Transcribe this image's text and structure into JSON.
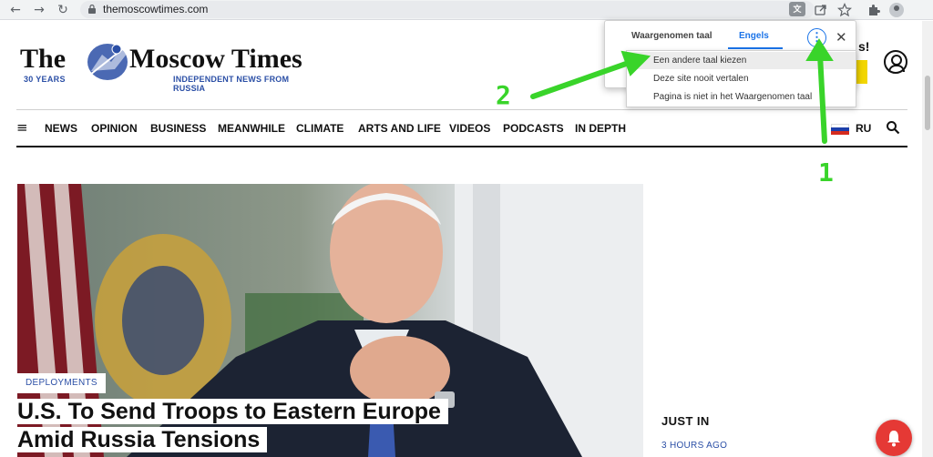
{
  "browser": {
    "url": "themoscowtimes.com",
    "back_icon": "←",
    "forward_icon": "→",
    "reload_icon": "↻",
    "translate_icon_label": "文"
  },
  "site": {
    "logo_the": "The",
    "logo_moscow": "Moscow Times",
    "years": "30 YEARS",
    "tagline": "INDEPENDENT NEWS FROM RUSSIA",
    "promo_fragment": "s!",
    "menu_icon": "≡",
    "nav": [
      "NEWS",
      "OPINION",
      "BUSINESS",
      "MEANWHILE",
      "CLIMATE",
      "ARTS AND LIFE",
      "VIDEOS",
      "PODCASTS",
      "IN DEPTH"
    ],
    "lang": "RU"
  },
  "hero": {
    "tag": "DEPLOYMENTS",
    "headline_line1": "U.S. To Send Troops to Eastern Europe",
    "headline_line2": "Amid Russia Tensions"
  },
  "sidebar": {
    "just_in": "JUST IN",
    "time": "3 HOURS AGO"
  },
  "translate_popup": {
    "tab_detected": "Waargenomen taal",
    "tab_english": "Engels",
    "more_icon": "⋮",
    "close_icon": "✕",
    "options": [
      "Een andere taal kiezen",
      "Deze site nooit vertalen",
      "Pagina is niet in het Waargenomen taal"
    ]
  },
  "annotations": {
    "step1": "1",
    "step2": "2",
    "color": "#39d42a"
  },
  "colors": {
    "brand_blue": "#2b4fa6",
    "accent_blue": "#1a73e8",
    "notification_red": "#e53935"
  }
}
